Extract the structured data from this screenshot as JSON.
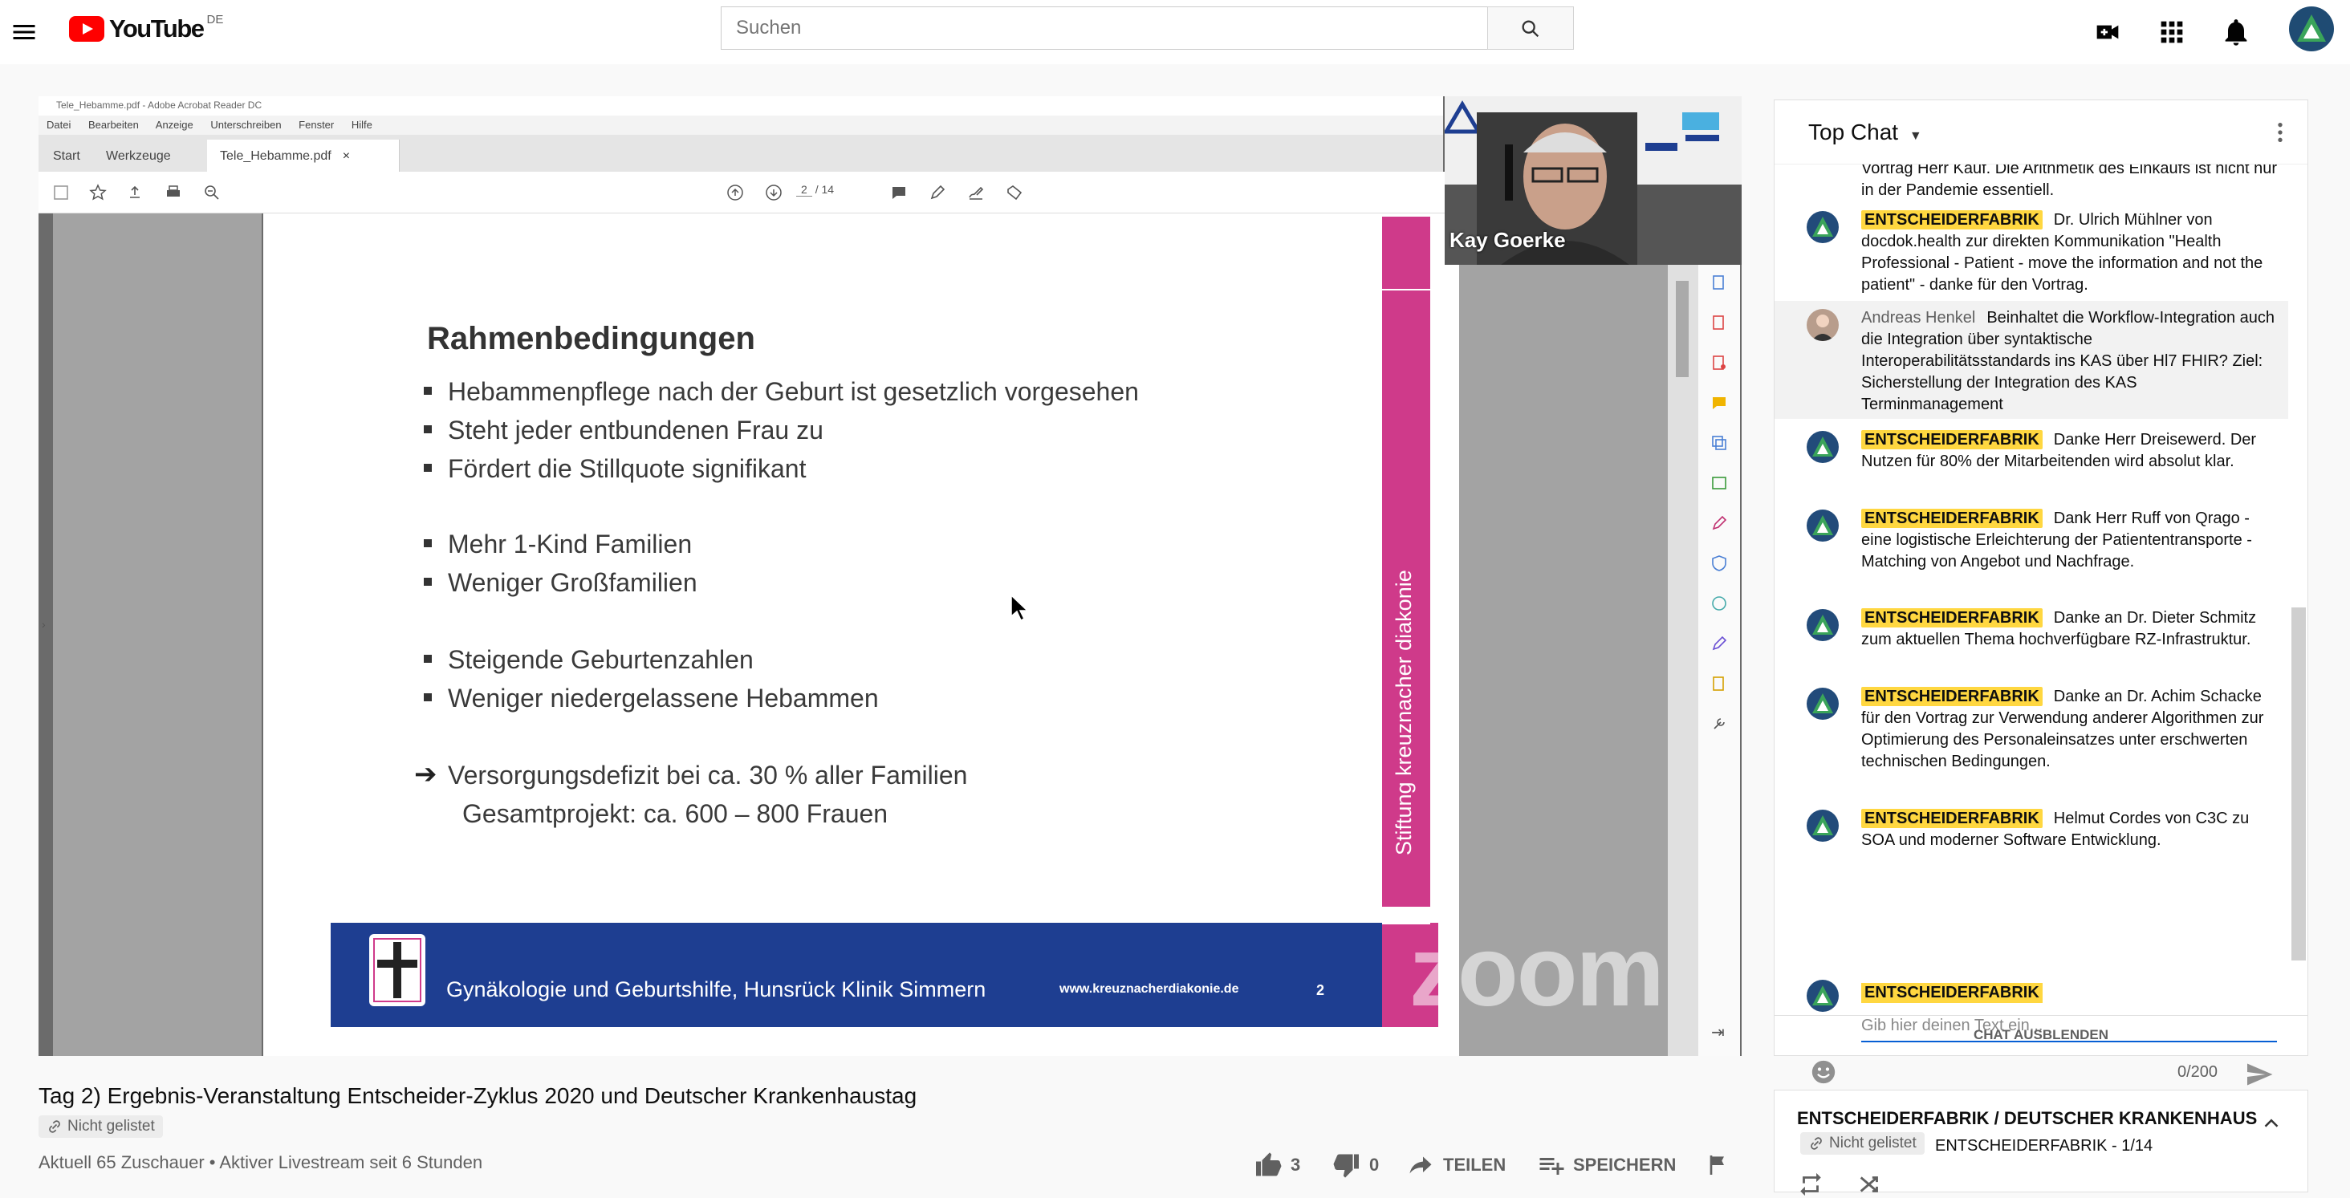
{
  "header": {
    "logo_text": "YouTube",
    "country": "DE",
    "search_placeholder": "Suchen"
  },
  "player": {
    "acrobat": {
      "window_title": "Tele_Hebamme.pdf - Adobe Acrobat Reader DC",
      "menu": [
        "Datei",
        "Bearbeiten",
        "Anzeige",
        "Unterschreiben",
        "Fenster",
        "Hilfe"
      ],
      "tabs": {
        "start": "Start",
        "tools": "Werkzeuge",
        "doc": "Tele_Hebamme.pdf"
      },
      "page_current": "2",
      "page_total": "/ 14"
    },
    "slide": {
      "title": "Rahmenbedingungen",
      "bullets": [
        "Hebammenpflege nach der Geburt ist gesetzlich vorgesehen",
        "Steht jeder entbundenen Frau zu",
        "Fördert die Stillquote signifikant",
        "Mehr 1-Kind Familien",
        "Weniger Großfamilien",
        "Steigende Geburtenzahlen",
        "Weniger niedergelassene Hebammen"
      ],
      "conclusion_line1": "Versorgungsdefizit bei ca. 30 % aller Familien",
      "conclusion_line2": "Gesamtprojekt:  ca. 600 – 800 Frauen",
      "side_text": "Stiftung kreuznacher diakonie",
      "footer_text": "Gynäkologie und Geburtshilfe, Hunsrück Klinik Simmern",
      "footer_url": "www.kreuznacherdiakonie.de",
      "footer_page": "2"
    },
    "speaker_name": "Kay Goerke",
    "watermark": "zoom"
  },
  "video": {
    "title": "Tag 2) Ergebnis-Veranstaltung Entscheider-Zyklus 2020 und Deutscher Krankenhaustag",
    "unlisted": "Nicht gelistet",
    "views": "Aktuell 65 Zuschauer • Aktiver Livestream seit 6 Stunden",
    "likes": "3",
    "dislikes": "0",
    "share": "TEILEN",
    "save": "SPEICHERN"
  },
  "chat": {
    "title": "Top Chat",
    "messages": [
      {
        "author": "",
        "badge": "",
        "text": "Vortrag Herr Kauf. Die Arithmetik des Einkaufs ist nicht nur in der Pandemie essentiell."
      },
      {
        "author": "",
        "badge": "ENTSCHEIDERFABRIK",
        "text": "Dr. Ulrich Mühlner von docdok.health zur direkten Kommunikation \"Health Professional - Patient - move the information and not the patient\" - danke für den Vortrag."
      },
      {
        "author": "Andreas Henkel",
        "badge": "",
        "text": "Beinhaltet die Workflow-Integration auch die Integration über syntaktische Interoperabilitätsstandards ins KAS über Hl7 FHIR? Ziel: Sicherstellung der Integration des KAS Terminmanagement"
      },
      {
        "author": "",
        "badge": "ENTSCHEIDERFABRIK",
        "text": "Danke Herr Dreisewerd. Der Nutzen für 80% der Mitarbeitenden wird absolut klar."
      },
      {
        "author": "",
        "badge": "ENTSCHEIDERFABRIK",
        "text": "Dank Herr Ruff von Qrago - eine logistische Erleichterung der Patiententransporte - Matching von Angebot und Nachfrage."
      },
      {
        "author": "",
        "badge": "ENTSCHEIDERFABRIK",
        "text": "Danke an Dr. Dieter Schmitz zum aktuellen Thema hochverfügbare RZ-Infrastruktur."
      },
      {
        "author": "",
        "badge": "ENTSCHEIDERFABRIK",
        "text": "Danke an Dr. Achim Schacke für den Vortrag zur Verwendung anderer Algorithmen zur Optimierung des Personaleinsatzes unter erschwerten technischen Bedingungen."
      },
      {
        "author": "",
        "badge": "ENTSCHEIDERFABRIK",
        "text": "Helmut Cordes von C3C zu SOA und moderner Software Entwicklung."
      }
    ],
    "composer_name": "ENTSCHEIDERFABRIK",
    "input_placeholder": "Gib hier deinen Text ein...",
    "counter": "0/200",
    "hide_label": "CHAT AUSBLENDEN"
  },
  "playlist": {
    "title": "ENTSCHEIDERFABRIK / DEUTSCHER KRANKENHAUS",
    "unlisted": "Nicht gelistet",
    "subtitle": "ENTSCHEIDERFABRIK - 1/14"
  },
  "colors": {
    "youtube_red": "#ff0000",
    "badge_yellow": "#ffd740",
    "slide_magenta": "#cf3a8a",
    "slide_blue": "#1e3e91"
  }
}
